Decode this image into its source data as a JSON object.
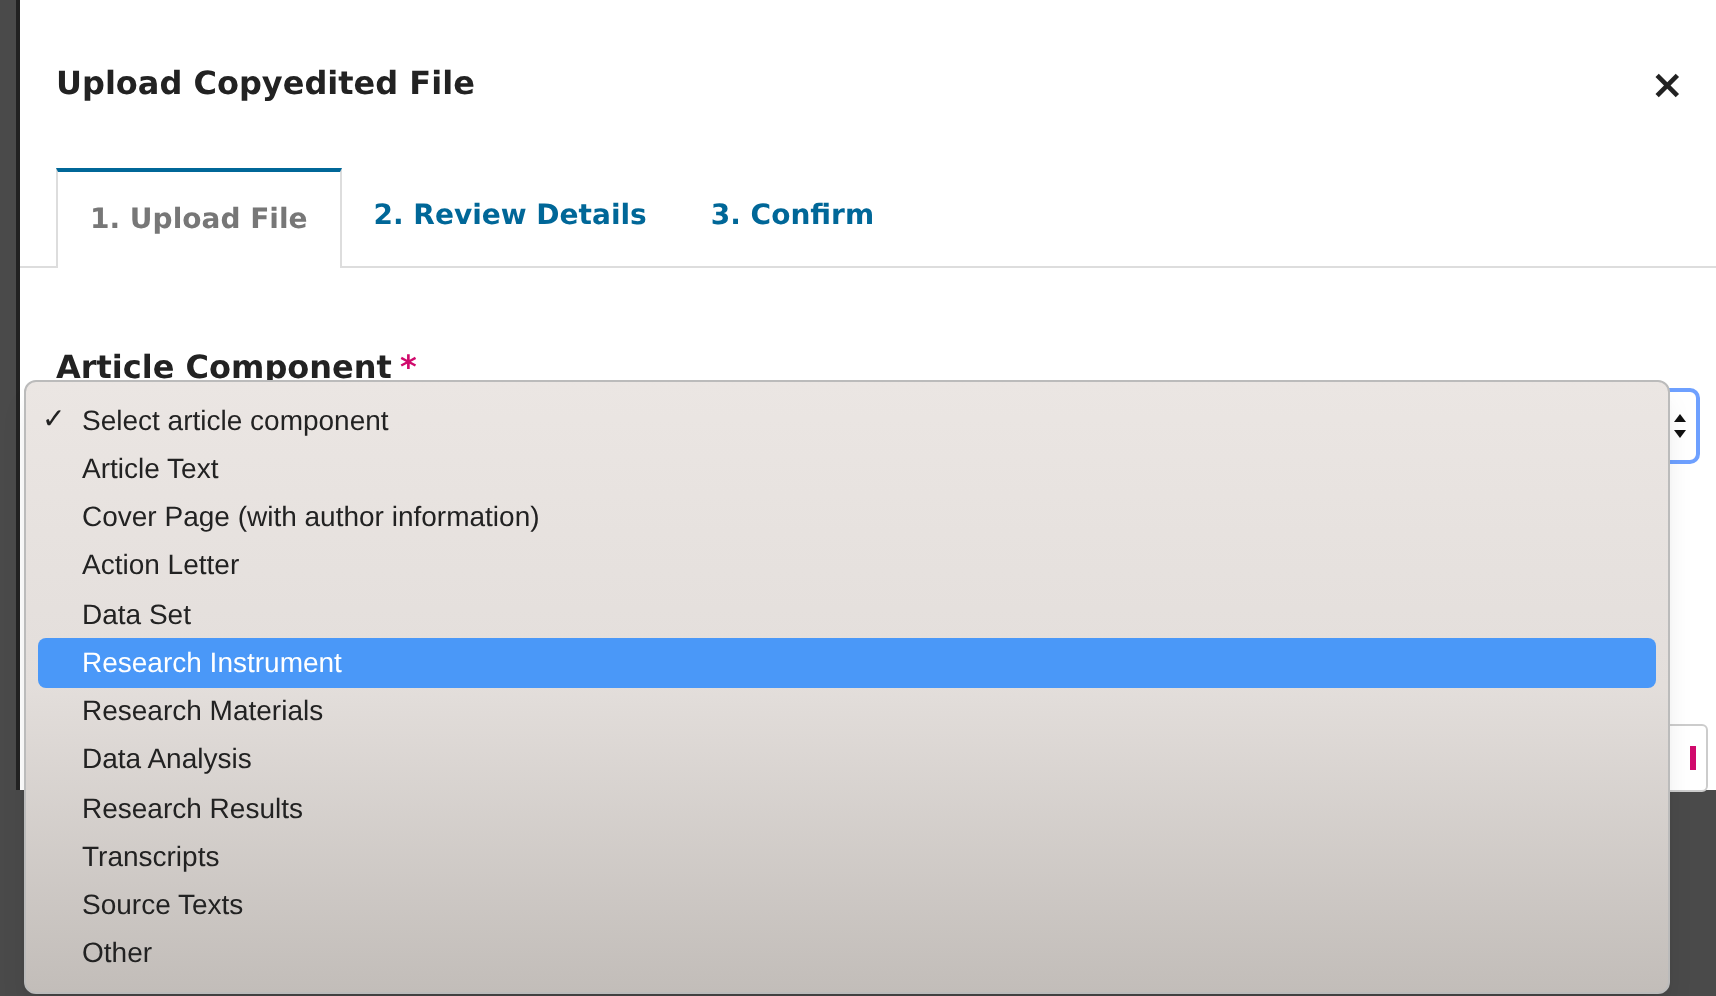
{
  "dialog": {
    "title": "Upload Copyedited File",
    "close": "×"
  },
  "tabs": [
    {
      "label": "1. Upload File",
      "selected": true
    },
    {
      "label": "2. Review Details",
      "selected": false
    },
    {
      "label": "3. Confirm",
      "selected": false
    }
  ],
  "field": {
    "label": "Article Component",
    "required": "*"
  },
  "dropdown": {
    "options": [
      {
        "label": "Select article component",
        "checked": true,
        "highlighted": false
      },
      {
        "label": "Article Text",
        "checked": false,
        "highlighted": false
      },
      {
        "label": "Cover Page (with author information)",
        "checked": false,
        "highlighted": false
      },
      {
        "label": "Action Letter",
        "checked": false,
        "highlighted": false
      },
      {
        "label": "Data Set",
        "checked": false,
        "highlighted": false
      },
      {
        "label": "Research Instrument",
        "checked": false,
        "highlighted": true
      },
      {
        "label": "Research Materials",
        "checked": false,
        "highlighted": false
      },
      {
        "label": "Data Analysis",
        "checked": false,
        "highlighted": false
      },
      {
        "label": "Research Results",
        "checked": false,
        "highlighted": false
      },
      {
        "label": "Transcripts",
        "checked": false,
        "highlighted": false
      },
      {
        "label": "Source Texts",
        "checked": false,
        "highlighted": false
      },
      {
        "label": "Other",
        "checked": false,
        "highlighted": false
      }
    ],
    "check_mark": "✓"
  }
}
